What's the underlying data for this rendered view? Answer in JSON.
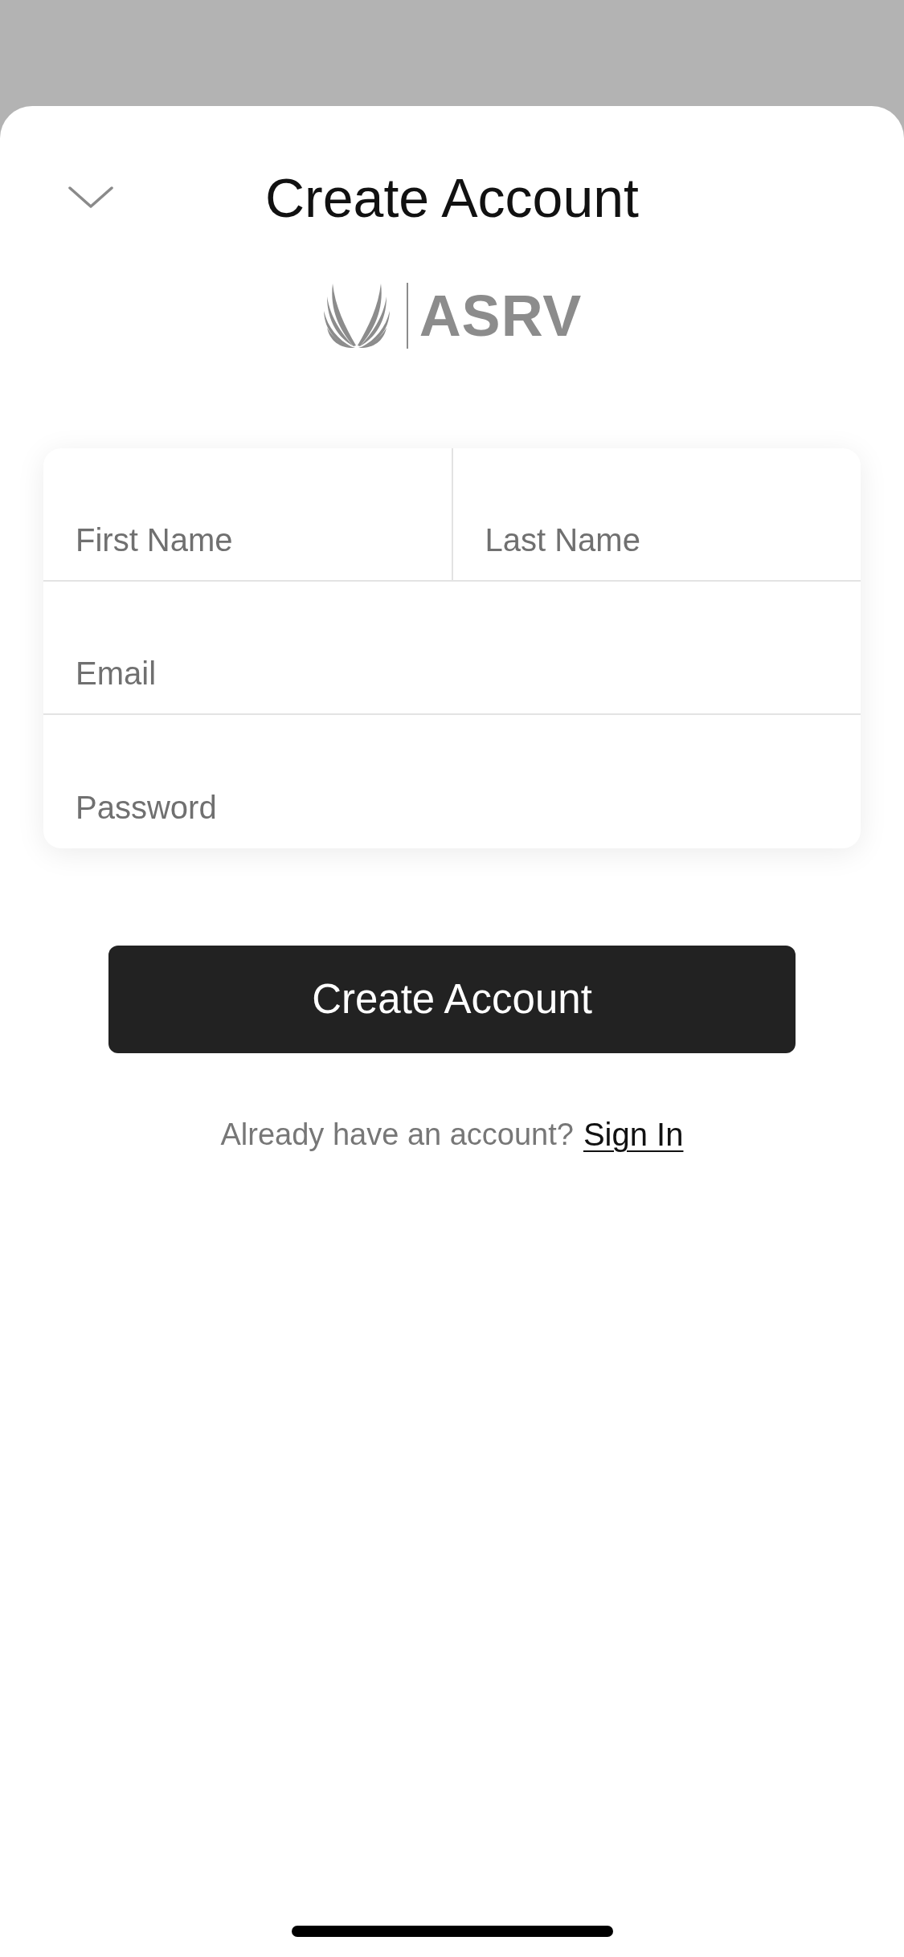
{
  "header": {
    "title": "Create Account"
  },
  "logo": {
    "wordmark": "ASRV"
  },
  "form": {
    "rows": [
      {
        "fields": [
          {
            "placeholder": "First Name"
          },
          {
            "placeholder": "Last Name"
          }
        ]
      },
      {
        "fields": [
          {
            "placeholder": "Email"
          }
        ]
      },
      {
        "fields": [
          {
            "placeholder": "Password"
          }
        ]
      }
    ]
  },
  "submit_button": {
    "label": "Create Account"
  },
  "sign_in_prompt": {
    "text": "Already have an account?",
    "link": "Sign In"
  }
}
